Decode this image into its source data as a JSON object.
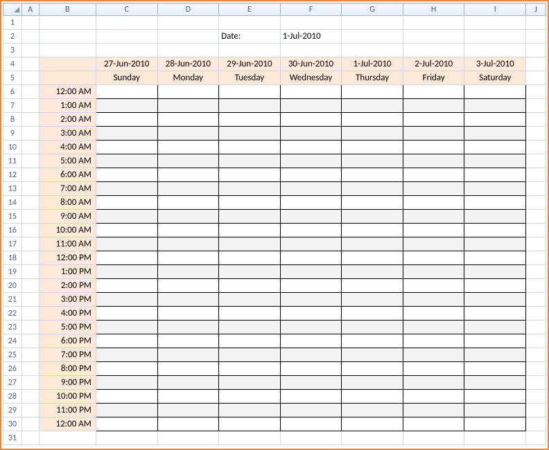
{
  "columns": [
    "A",
    "B",
    "C",
    "D",
    "E",
    "F",
    "G",
    "H",
    "I",
    "J"
  ],
  "date_label": "Date:",
  "date_value": "1-Jul-2010",
  "days": [
    {
      "date": "27-Jun-2010",
      "name": "Sunday"
    },
    {
      "date": "28-Jun-2010",
      "name": "Monday"
    },
    {
      "date": "29-Jun-2010",
      "name": "Tuesday"
    },
    {
      "date": "30-Jun-2010",
      "name": "Wednesday"
    },
    {
      "date": "1-Jul-2010",
      "name": "Thursday"
    },
    {
      "date": "2-Jul-2010",
      "name": "Friday"
    },
    {
      "date": "3-Jul-2010",
      "name": "Saturday"
    }
  ],
  "times": [
    "12:00 AM",
    "1:00 AM",
    "2:00 AM",
    "3:00 AM",
    "4:00 AM",
    "5:00 AM",
    "6:00 AM",
    "7:00 AM",
    "8:00 AM",
    "9:00 AM",
    "10:00 AM",
    "11:00 AM",
    "12:00 PM",
    "1:00 PM",
    "2:00 PM",
    "3:00 PM",
    "4:00 PM",
    "5:00 PM",
    "6:00 PM",
    "7:00 PM",
    "8:00 PM",
    "9:00 PM",
    "10:00 PM",
    "11:00 PM",
    "12:00 AM"
  ],
  "total_rows": 31
}
